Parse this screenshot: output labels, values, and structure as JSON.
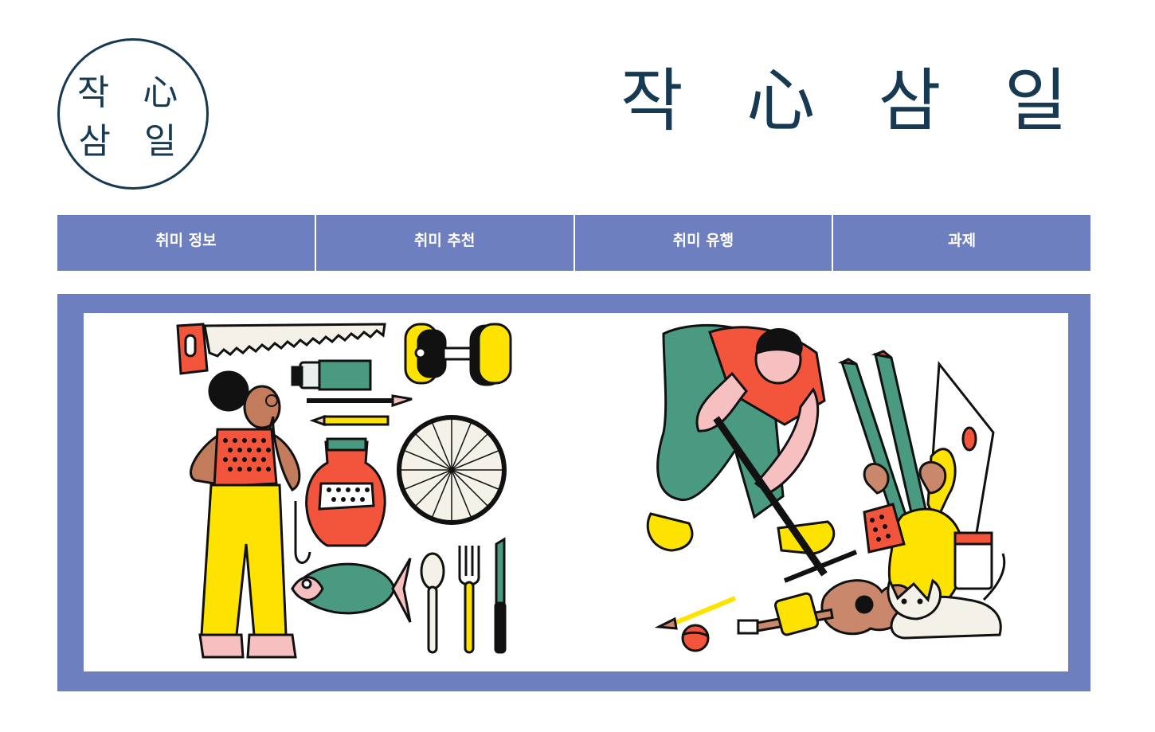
{
  "logo": {
    "line1": "작 心",
    "line2": "삼 일"
  },
  "site_title": "작 心 삼 일",
  "nav": {
    "items": [
      {
        "label": "취미 정보"
      },
      {
        "label": "취미 추천"
      },
      {
        "label": "취미 유행"
      },
      {
        "label": "과제"
      }
    ]
  },
  "colors": {
    "brand_navy": "#173a52",
    "nav_blue": "#6d7fbe",
    "illustration_red": "#f2553b",
    "illustration_yellow": "#ffe300",
    "illustration_teal": "#4a9a82",
    "illustration_pink": "#f6c0c0"
  },
  "banner": {
    "left_illustration": [
      "saw",
      "dumbbell",
      "paint-tube",
      "paintbrush",
      "pencil",
      "woman",
      "vase",
      "bicycle-wheel",
      "fish-hook",
      "fish",
      "spoon",
      "fork",
      "knife"
    ],
    "right_illustration": [
      "man-with-broom",
      "skis",
      "guitar",
      "cat",
      "paintbrush",
      "ball",
      "vase",
      "plant"
    ]
  }
}
